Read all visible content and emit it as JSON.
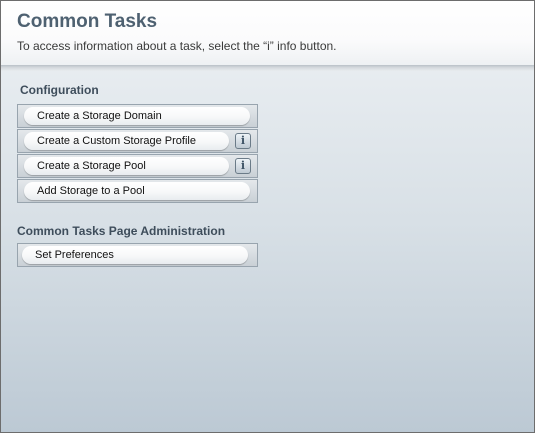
{
  "header": {
    "title": "Common Tasks",
    "subtitle": "To access information about a task, select the “i” info button."
  },
  "configuration": {
    "heading": "Configuration",
    "tasks": [
      {
        "label": "Create a Storage Domain",
        "has_info": false
      },
      {
        "label": "Create a Custom Storage Profile",
        "has_info": true,
        "info_glyph": "i"
      },
      {
        "label": "Create a Storage Pool",
        "has_info": true,
        "info_glyph": "i"
      },
      {
        "label": "Add Storage to a Pool",
        "has_info": false
      }
    ]
  },
  "administration": {
    "heading": "Common Tasks Page Administration",
    "tasks": [
      {
        "label": "Set Preferences",
        "has_info": false
      }
    ]
  },
  "icons": {
    "info": "info-icon"
  },
  "colors": {
    "title": "#4e6171",
    "heading": "#3e4d5b",
    "info_glyph": "#3f5466"
  }
}
